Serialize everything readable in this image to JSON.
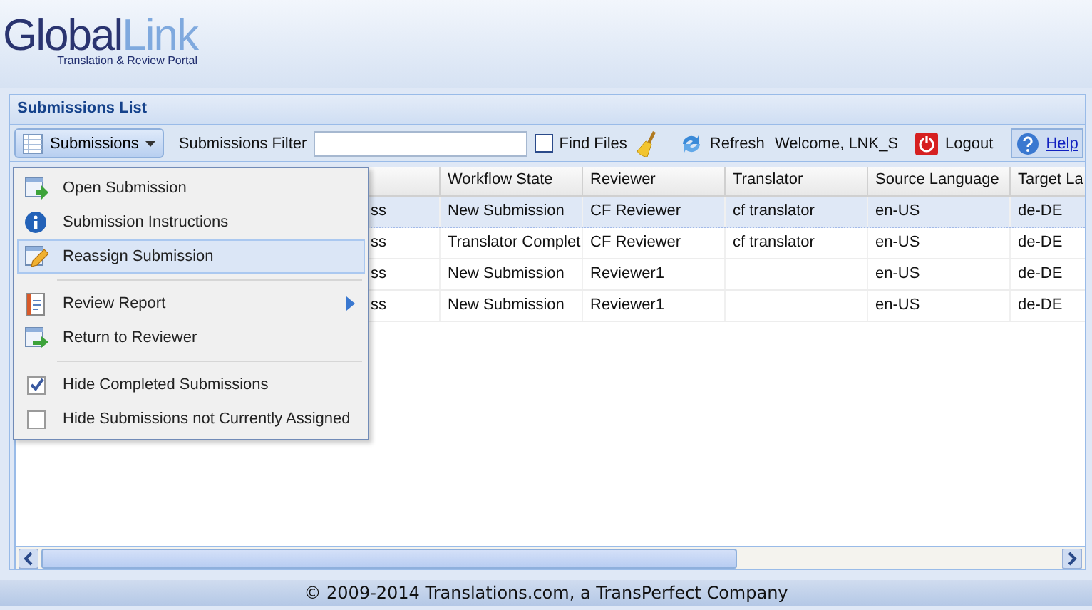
{
  "logo": {
    "name_a": "Global",
    "name_b": "Link",
    "tagline": "Translation & Review Portal"
  },
  "panel": {
    "title": "Submissions List"
  },
  "toolbar": {
    "menu_button": "Submissions",
    "filter_label": "Submissions Filter",
    "find_files": {
      "label": "Find Files",
      "checked": false
    },
    "refresh": "Refresh",
    "welcome": "Welcome, LNK_S",
    "logout": "Logout",
    "help": "Help"
  },
  "table": {
    "columns": [
      "",
      "Workflow State",
      "Reviewer",
      "Translator",
      "Source Language",
      "Target La"
    ],
    "rows": [
      {
        "selected": true,
        "cells": [
          "ss",
          "New Submission",
          "CF Reviewer",
          "cf translator",
          "en-US",
          "de-DE"
        ]
      },
      {
        "selected": false,
        "cells": [
          "ss",
          "Translator Complet",
          "CF Reviewer",
          "cf translator",
          "en-US",
          "de-DE"
        ]
      },
      {
        "selected": false,
        "cells": [
          "ss",
          "New Submission",
          "Reviewer1",
          "",
          "en-US",
          "de-DE"
        ]
      },
      {
        "selected": false,
        "cells": [
          "ss",
          "New Submission",
          "Reviewer1",
          "",
          "en-US",
          "de-DE"
        ]
      }
    ]
  },
  "menu": [
    {
      "kind": "action",
      "label": "Open Submission",
      "selected": false
    },
    {
      "kind": "action",
      "label": "Submission Instructions",
      "selected": false
    },
    {
      "kind": "action",
      "label": "Reassign Submission",
      "selected": true
    },
    {
      "kind": "separator"
    },
    {
      "kind": "submenu",
      "label": "Review Report",
      "selected": false
    },
    {
      "kind": "action",
      "label": "Return to Reviewer",
      "selected": false
    },
    {
      "kind": "separator"
    },
    {
      "kind": "check",
      "label": "Hide Completed Submissions",
      "checked": true,
      "selected": false
    },
    {
      "kind": "check",
      "label": "Hide Submissions not Currently Assigned",
      "checked": false,
      "selected": false
    }
  ],
  "footer": "© 2009-2014 Translations.com, a TransPerfect Company"
}
